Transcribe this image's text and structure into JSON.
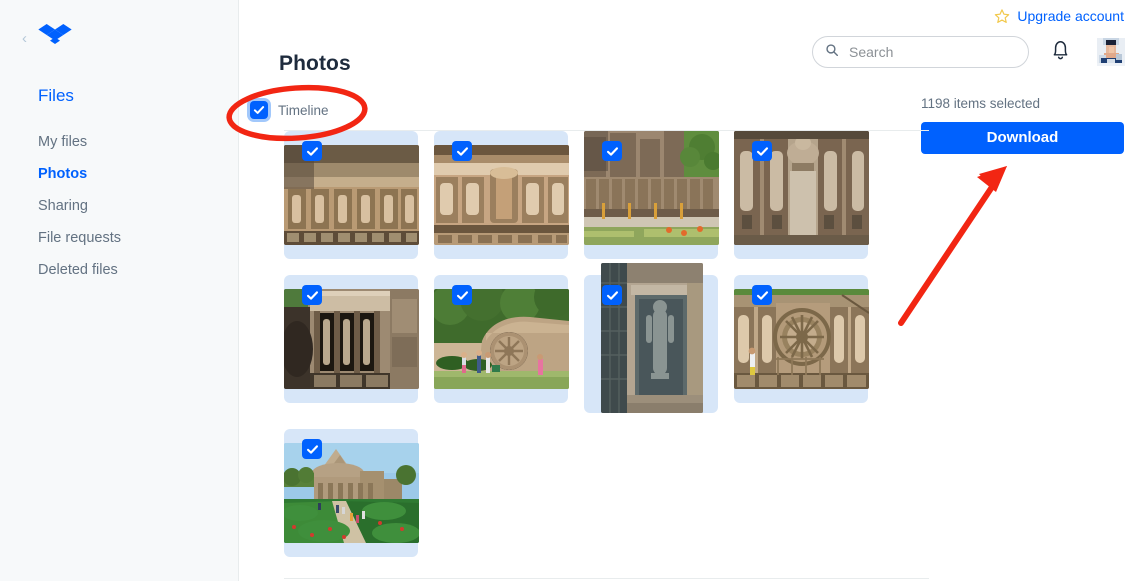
{
  "app": {
    "name": "Dropbox",
    "logo_icon": "dropbox-logo-icon",
    "collapse_icon": "chevron-left-icon"
  },
  "colors": {
    "brand_blue": "#0061fe",
    "sidebar_bg": "#f7f9fa",
    "tile_bg": "#d7e6f8",
    "muted_text": "#637282",
    "annotation_red": "#f22613"
  },
  "sidebar": {
    "section_label": "Files",
    "items": [
      {
        "label": "My files",
        "active": false,
        "name": "sidebar-item-my-files"
      },
      {
        "label": "Photos",
        "active": true,
        "name": "sidebar-item-photos"
      },
      {
        "label": "Sharing",
        "active": false,
        "name": "sidebar-item-sharing"
      },
      {
        "label": "File requests",
        "active": false,
        "name": "sidebar-item-file-requests"
      },
      {
        "label": "Deleted files",
        "active": false,
        "name": "sidebar-item-deleted-files"
      }
    ]
  },
  "header": {
    "upgrade_label": "Upgrade account",
    "star_icon": "star-outline-icon",
    "bell_icon": "bell-icon",
    "avatar_icon": "user-avatar",
    "page_title": "Photos"
  },
  "search": {
    "placeholder": "Search",
    "value": "",
    "icon": "search-icon"
  },
  "toolbar": {
    "timeline_label": "Timeline",
    "timeline_checked": true,
    "checkbox_icon": "checkmark-icon"
  },
  "selection": {
    "count_text": "1198 items selected",
    "download_label": "Download"
  },
  "grid": {
    "rows": [
      [
        {
          "name": "photo-tile",
          "caption": "Carved stone temple wall panel with figures",
          "orientation": "landscape",
          "checked": true,
          "palette": [
            "#b99a74",
            "#8d7452",
            "#d8c0a0",
            "#5e4c38"
          ]
        },
        {
          "name": "photo-tile",
          "caption": "Ornate sandstone relief carvings close-up",
          "orientation": "landscape",
          "checked": true,
          "palette": [
            "#c7a582",
            "#9b7f5e",
            "#e0cbae",
            "#6b563e"
          ]
        },
        {
          "name": "photo-tile",
          "caption": "Temple terrace with green lawn and trees",
          "orientation": "landscape",
          "checked": true,
          "palette": [
            "#b9a28a",
            "#8fa65c",
            "#9ec1e0",
            "#6d5d49"
          ]
        },
        {
          "name": "photo-tile",
          "caption": "Stone shrine niche with pillars",
          "orientation": "landscape",
          "checked": true,
          "palette": [
            "#a08b72",
            "#7a6550",
            "#cbbba4",
            "#564a3b"
          ]
        }
      ],
      [
        {
          "name": "photo-tile",
          "caption": "Temple doorway with carved pillar figures",
          "orientation": "landscape",
          "checked": true,
          "palette": [
            "#9d8a72",
            "#6e5c47",
            "#c4b49c",
            "#40362a"
          ]
        },
        {
          "name": "photo-tile",
          "caption": "Stone chariot wheel with visitors and foliage",
          "orientation": "landscape",
          "checked": true,
          "palette": [
            "#bda484",
            "#4f7a3c",
            "#cdb696",
            "#9fb86c"
          ]
        },
        {
          "name": "photo-tile",
          "caption": "Standing deity sculpture in stone alcove",
          "orientation": "portrait",
          "checked": true,
          "palette": [
            "#9e8f7c",
            "#5d6a6b",
            "#c3b7a4",
            "#3f4a4c"
          ]
        },
        {
          "name": "photo-tile",
          "caption": "Large carved chariot wheel on temple base",
          "orientation": "landscape",
          "checked": true,
          "palette": [
            "#c0a888",
            "#8b7559",
            "#ddc9ab",
            "#6a583f"
          ]
        }
      ],
      [
        {
          "name": "photo-tile",
          "caption": "Sun temple pyramid with gardens and path",
          "orientation": "landscape",
          "checked": true,
          "palette": [
            "#b6a184",
            "#2f7a32",
            "#9cc9e8",
            "#58813a"
          ]
        }
      ]
    ]
  },
  "annotations": [
    {
      "name": "annotation-ellipse-timeline-checkbox",
      "type": "ellipse",
      "color": "#f22613"
    },
    {
      "name": "annotation-arrow-download-button",
      "type": "arrow",
      "color": "#f22613"
    }
  ]
}
